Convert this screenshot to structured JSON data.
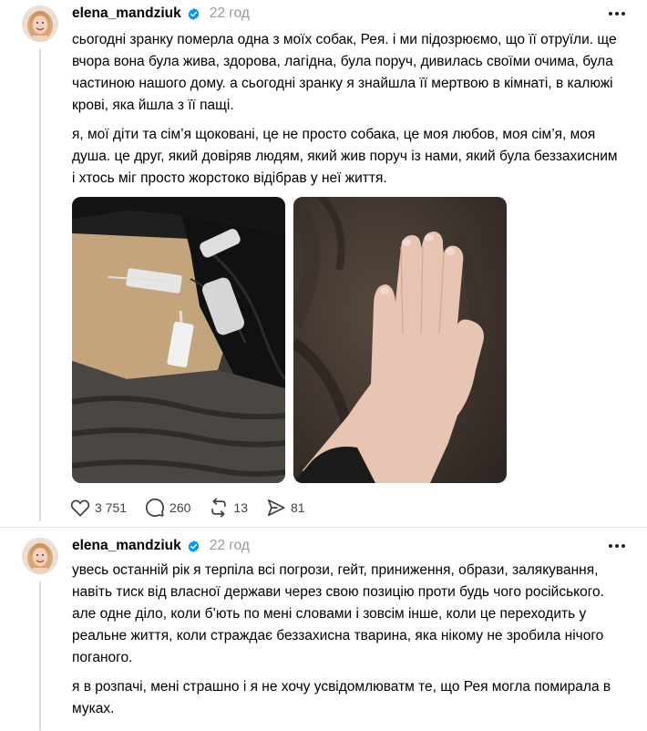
{
  "post1": {
    "username": "elena_mandziuk",
    "time": "22 год",
    "paragraph1": "сьогодні зранку померла одна з моїх собак, Рея. і ми підозрюємо, що її отруїли. ще вчора вона була жива, здорова, лагідна, була поруч, дивилась своїми очима, була частиною нашого дому. а сьогодні зранку я знайшла її мертвою в кімнаті, в калюжі крові, яка йшла з її пащі.",
    "paragraph2": "я, мої діти та сім’я щоковані, це не просто собака, це моя любов, моя сім’я, моя душа. це друг, який довіряв людям, який жив поруч із нами, який була беззахисним і хтось міг просто жорстоко відібрав у неї життя.",
    "likes": "3 751",
    "comments": "260",
    "reposts": "13",
    "shares": "81"
  },
  "post2": {
    "username": "elena_mandziuk",
    "time": "22 год",
    "paragraph1": "увесь останній рік я терпіла всі погрози, гейт, приниження, образи, залякування, навіть тиск від власної держави через свою позицію проти будь чого російського. але одне діло, коли б’ють по мені словами і зовсім інше, коли це переходить у реальне життя, коли страждає беззахисна тварина, яка нікому не зробила нічого поганого.",
    "paragraph2": "я в розпачі, мені страшно і я не хочу усвідомлюватм те, що Рея могла помирала в муках."
  },
  "icons": {
    "verified": "verified-badge-icon",
    "more": "more-options-icon",
    "like": "heart-icon",
    "comment": "comment-icon",
    "repost": "repost-icon",
    "share": "share-icon"
  },
  "colors": {
    "verified": "#0095f6",
    "secondary_text": "#999999",
    "thread_line": "#dcdcdc"
  }
}
